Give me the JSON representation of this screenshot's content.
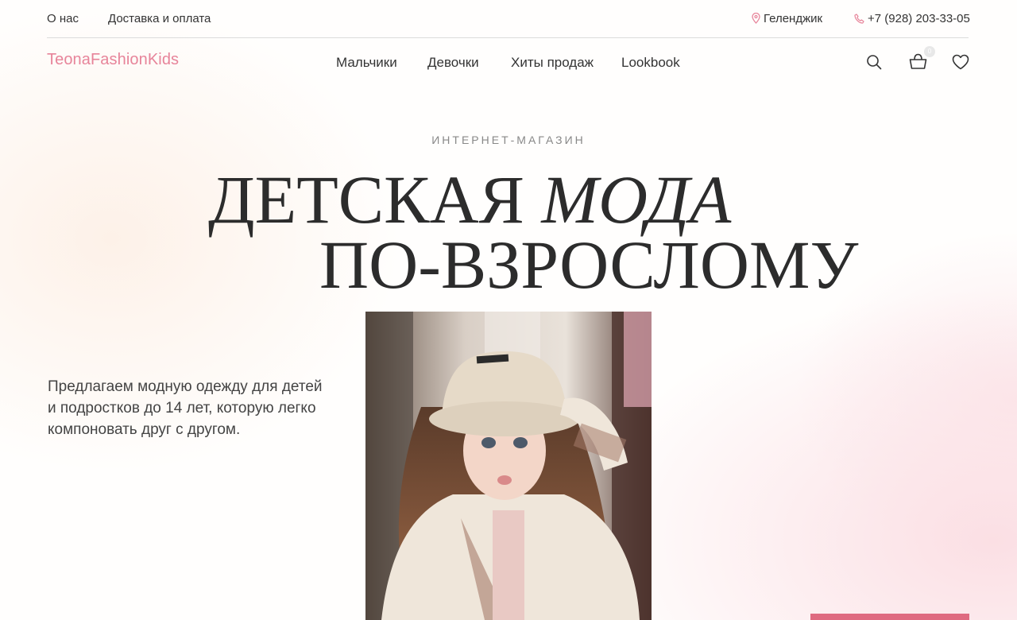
{
  "topbar": {
    "about": "О нас",
    "delivery": "Доставка и оплата",
    "city": "Геленджик",
    "phone": "+7 (928) 203-33-05"
  },
  "brand": {
    "logo": "TeonaFashionKids",
    "accent_color": "#e7849a"
  },
  "nav": {
    "items": [
      "Мальчики",
      "Девочки",
      "Хиты продаж",
      "Lookbook"
    ]
  },
  "header_icons": {
    "search": "search-icon",
    "cart": "cart-icon",
    "favorites": "heart-icon",
    "cart_count": "0"
  },
  "hero": {
    "eyebrow": "ИНТЕРНЕТ-МАГАЗИН",
    "line1_regular": "ДЕТСКАЯ",
    "line1_italic": "МОДА",
    "line2": "ПО-ВЗРОСЛОМУ",
    "lead": "Предлагаем модную одежду для детей и подростков до 14 лет, которую легко компоновать друг с другом.",
    "cta_color": "#df6a80"
  }
}
